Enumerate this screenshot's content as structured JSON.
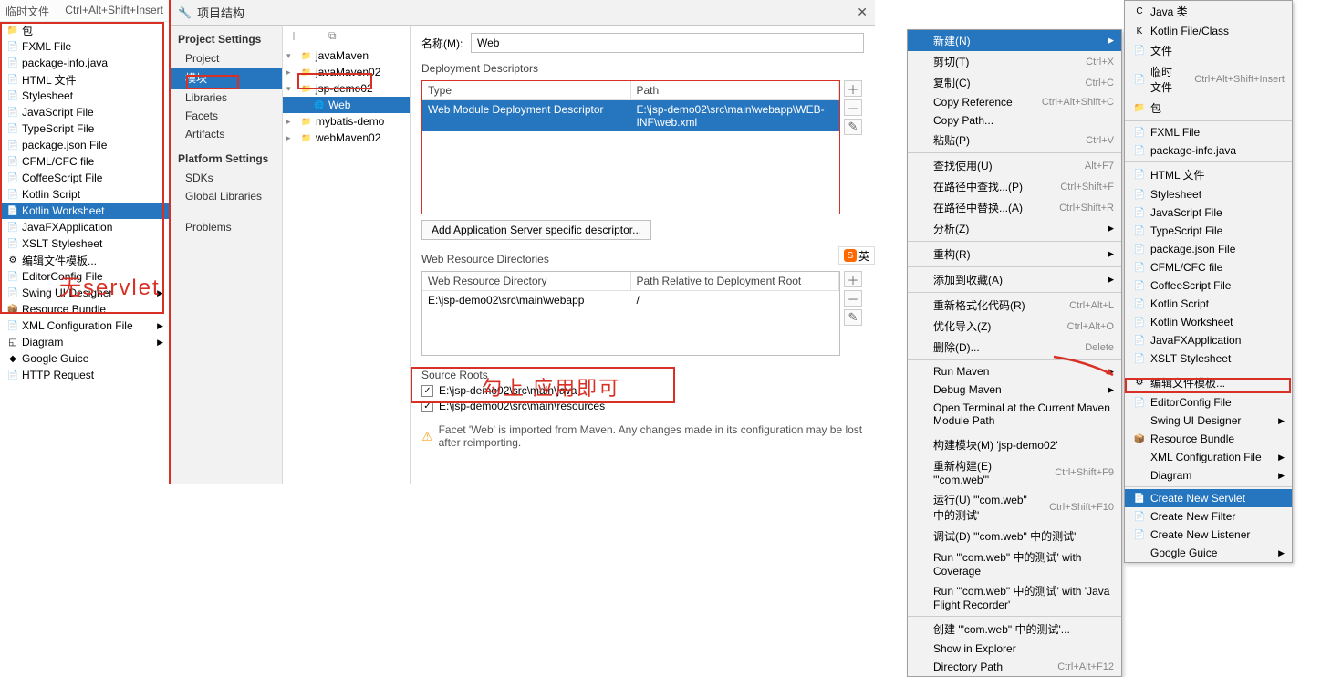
{
  "col1": {
    "head": {
      "label": "临时文件",
      "shortcut": "Ctrl+Alt+Shift+Insert"
    },
    "bao": "包",
    "items": [
      {
        "label": "FXML File",
        "ico": "📄"
      },
      {
        "label": "package-info.java",
        "ico": "📄"
      },
      {
        "label": "HTML 文件",
        "ico": "📄"
      },
      {
        "label": "Stylesheet",
        "ico": "📄"
      },
      {
        "label": "JavaScript File",
        "ico": "📄"
      },
      {
        "label": "TypeScript File",
        "ico": "📄"
      },
      {
        "label": "package.json File",
        "ico": "📄"
      },
      {
        "label": "CFML/CFC file",
        "ico": "📄"
      },
      {
        "label": "CoffeeScript File",
        "ico": "📄"
      },
      {
        "label": "Kotlin Script",
        "ico": "📄"
      },
      {
        "label": "Kotlin Worksheet",
        "ico": "📄",
        "sel": true
      },
      {
        "label": "JavaFXApplication",
        "ico": "📄"
      },
      {
        "label": "XSLT Stylesheet",
        "ico": "📄"
      },
      {
        "label": "编辑文件模板...",
        "ico": "⚙"
      },
      {
        "label": "EditorConfig File",
        "ico": "📄"
      },
      {
        "label": "Swing UI Designer",
        "ico": "📄",
        "arrow": true
      },
      {
        "label": "Resource Bundle",
        "ico": "📦"
      },
      {
        "label": "XML Configuration File",
        "ico": "📄",
        "arrow": true
      },
      {
        "label": "Diagram",
        "ico": "◱",
        "arrow": true
      },
      {
        "label": "Google Guice",
        "ico": "◆"
      },
      {
        "label": "HTTP Request",
        "ico": "📄"
      }
    ],
    "overlay": "无servlet"
  },
  "dialog": {
    "title": "项目结构",
    "side": {
      "hd1": "Project Settings",
      "items1": [
        "Project",
        "模块",
        "Libraries",
        "Facets",
        "Artifacts"
      ],
      "sel1": 1,
      "hd2": "Platform Settings",
      "items2": [
        "SDKs",
        "Global Libraries"
      ],
      "problems": "Problems"
    },
    "tree": [
      {
        "label": "javaMaven",
        "lvl": 0,
        "ico": "folder",
        "fold": "v"
      },
      {
        "label": "javaMaven02",
        "lvl": 0,
        "ico": "folder",
        "fold": ">"
      },
      {
        "label": "jsp-demo02",
        "lvl": 0,
        "ico": "folder",
        "fold": "v"
      },
      {
        "label": "Web",
        "lvl": 1,
        "ico": "web",
        "sel": true
      },
      {
        "label": "mybatis-demo",
        "lvl": 0,
        "ico": "folder",
        "fold": ">"
      },
      {
        "label": "webMaven02",
        "lvl": 0,
        "ico": "folder",
        "fold": ">"
      }
    ],
    "main": {
      "name_lbl": "名称(M):",
      "name_val": "Web",
      "dep_hd": "Deployment Descriptors",
      "dep_th": [
        "Type",
        "Path"
      ],
      "dep_row": [
        "Web Module Deployment Descriptor",
        "E:\\jsp-demo02\\src\\main\\webapp\\WEB-INF\\web.xml"
      ],
      "add_btn": "Add Application Server specific descriptor...",
      "res_hd": "Web Resource Directories",
      "res_th": [
        "Web Resource Directory",
        "Path Relative to Deployment Root"
      ],
      "res_row": [
        "E:\\jsp-demo02\\src\\main\\webapp",
        "/"
      ],
      "src_hd": "Source Roots",
      "src_items": [
        "E:\\jsp-demo02\\src\\main\\java",
        "E:\\jsp-demo02\\src\\main\\resources"
      ],
      "warn": "Facet 'Web' is imported from Maven. Any changes made in its configuration may be lost after reimporting.",
      "overlay": "勾上 应用即可"
    }
  },
  "ctx1": {
    "items": [
      {
        "label": "新建(N)",
        "arrow": true,
        "sel": true
      },
      {
        "label": "剪切(T)",
        "sc": "Ctrl+X"
      },
      {
        "label": "复制(C)",
        "sc": "Ctrl+C"
      },
      {
        "label": "Copy Reference",
        "sc": "Ctrl+Alt+Shift+C"
      },
      {
        "label": "Copy Path..."
      },
      {
        "label": "粘贴(P)",
        "sc": "Ctrl+V"
      },
      {
        "sep": true
      },
      {
        "label": "查找使用(U)",
        "sc": "Alt+F7"
      },
      {
        "label": "在路径中查找...(P)",
        "sc": "Ctrl+Shift+F"
      },
      {
        "label": "在路径中替换...(A)",
        "sc": "Ctrl+Shift+R"
      },
      {
        "label": "分析(Z)",
        "arrow": true
      },
      {
        "sep": true
      },
      {
        "label": "重构(R)",
        "arrow": true
      },
      {
        "sep": true
      },
      {
        "label": "添加到收藏(A)",
        "arrow": true
      },
      {
        "sep": true
      },
      {
        "label": "重新格式化代码(R)",
        "sc": "Ctrl+Alt+L"
      },
      {
        "label": "优化导入(Z)",
        "sc": "Ctrl+Alt+O"
      },
      {
        "label": "删除(D)...",
        "sc": "Delete"
      },
      {
        "sep": true
      },
      {
        "label": "Run Maven",
        "arrow": true
      },
      {
        "label": "Debug Maven",
        "arrow": true
      },
      {
        "label": "Open Terminal at the Current Maven Module Path"
      },
      {
        "sep": true
      },
      {
        "label": "构建模块(M) 'jsp-demo02'"
      },
      {
        "label": "重新构建(E) '\"com.web\"'",
        "sc": "Ctrl+Shift+F9"
      },
      {
        "label": "运行(U) '\"com.web\" 中的测试'",
        "sc": "Ctrl+Shift+F10"
      },
      {
        "label": "调试(D) '\"com.web\" 中的测试'"
      },
      {
        "label": "Run '\"com.web\" 中的测试' with Coverage"
      },
      {
        "label": "Run '\"com.web\" 中的测试' with 'Java Flight Recorder'"
      },
      {
        "sep": true
      },
      {
        "label": "创建 '\"com.web\" 中的测试'..."
      },
      {
        "label": "Show in Explorer"
      },
      {
        "label": "Directory Path",
        "sc": "Ctrl+Alt+F12"
      }
    ]
  },
  "ctx2": {
    "items": [
      {
        "label": "Java 类",
        "ico": "C"
      },
      {
        "label": "Kotlin File/Class",
        "ico": "K"
      },
      {
        "label": "文件",
        "ico": "📄"
      },
      {
        "label": "临时文件",
        "sc": "Ctrl+Alt+Shift+Insert",
        "ico": "📄"
      },
      {
        "label": "包",
        "ico": "📁"
      },
      {
        "sep": true
      },
      {
        "label": "FXML File",
        "ico": "📄"
      },
      {
        "label": "package-info.java",
        "ico": "📄"
      },
      {
        "sep": true
      },
      {
        "label": "HTML 文件",
        "ico": "📄"
      },
      {
        "label": "Stylesheet",
        "ico": "📄"
      },
      {
        "label": "JavaScript File",
        "ico": "📄"
      },
      {
        "label": "TypeScript File",
        "ico": "📄"
      },
      {
        "label": "package.json File",
        "ico": "📄"
      },
      {
        "label": "CFML/CFC file",
        "ico": "📄"
      },
      {
        "label": "CoffeeScript File",
        "ico": "📄"
      },
      {
        "label": "Kotlin Script",
        "ico": "📄"
      },
      {
        "label": "Kotlin Worksheet",
        "ico": "📄"
      },
      {
        "label": "JavaFXApplication",
        "ico": "📄"
      },
      {
        "label": "XSLT Stylesheet",
        "ico": "📄"
      },
      {
        "sep": true
      },
      {
        "label": "编辑文件模板...",
        "ico": "⚙"
      },
      {
        "label": "EditorConfig File",
        "ico": "📄"
      },
      {
        "label": "Swing UI Designer",
        "arrow": true
      },
      {
        "label": "Resource Bundle",
        "ico": "📦"
      },
      {
        "label": "XML Configuration File",
        "arrow": true
      },
      {
        "label": "Diagram",
        "arrow": true
      },
      {
        "sep": true
      },
      {
        "label": "Create New Servlet",
        "ico": "📄",
        "sel": true
      },
      {
        "label": "Create New Filter",
        "ico": "📄"
      },
      {
        "label": "Create New Listener",
        "ico": "📄"
      },
      {
        "label": "Google Guice",
        "arrow": true
      }
    ]
  },
  "ime": "英"
}
